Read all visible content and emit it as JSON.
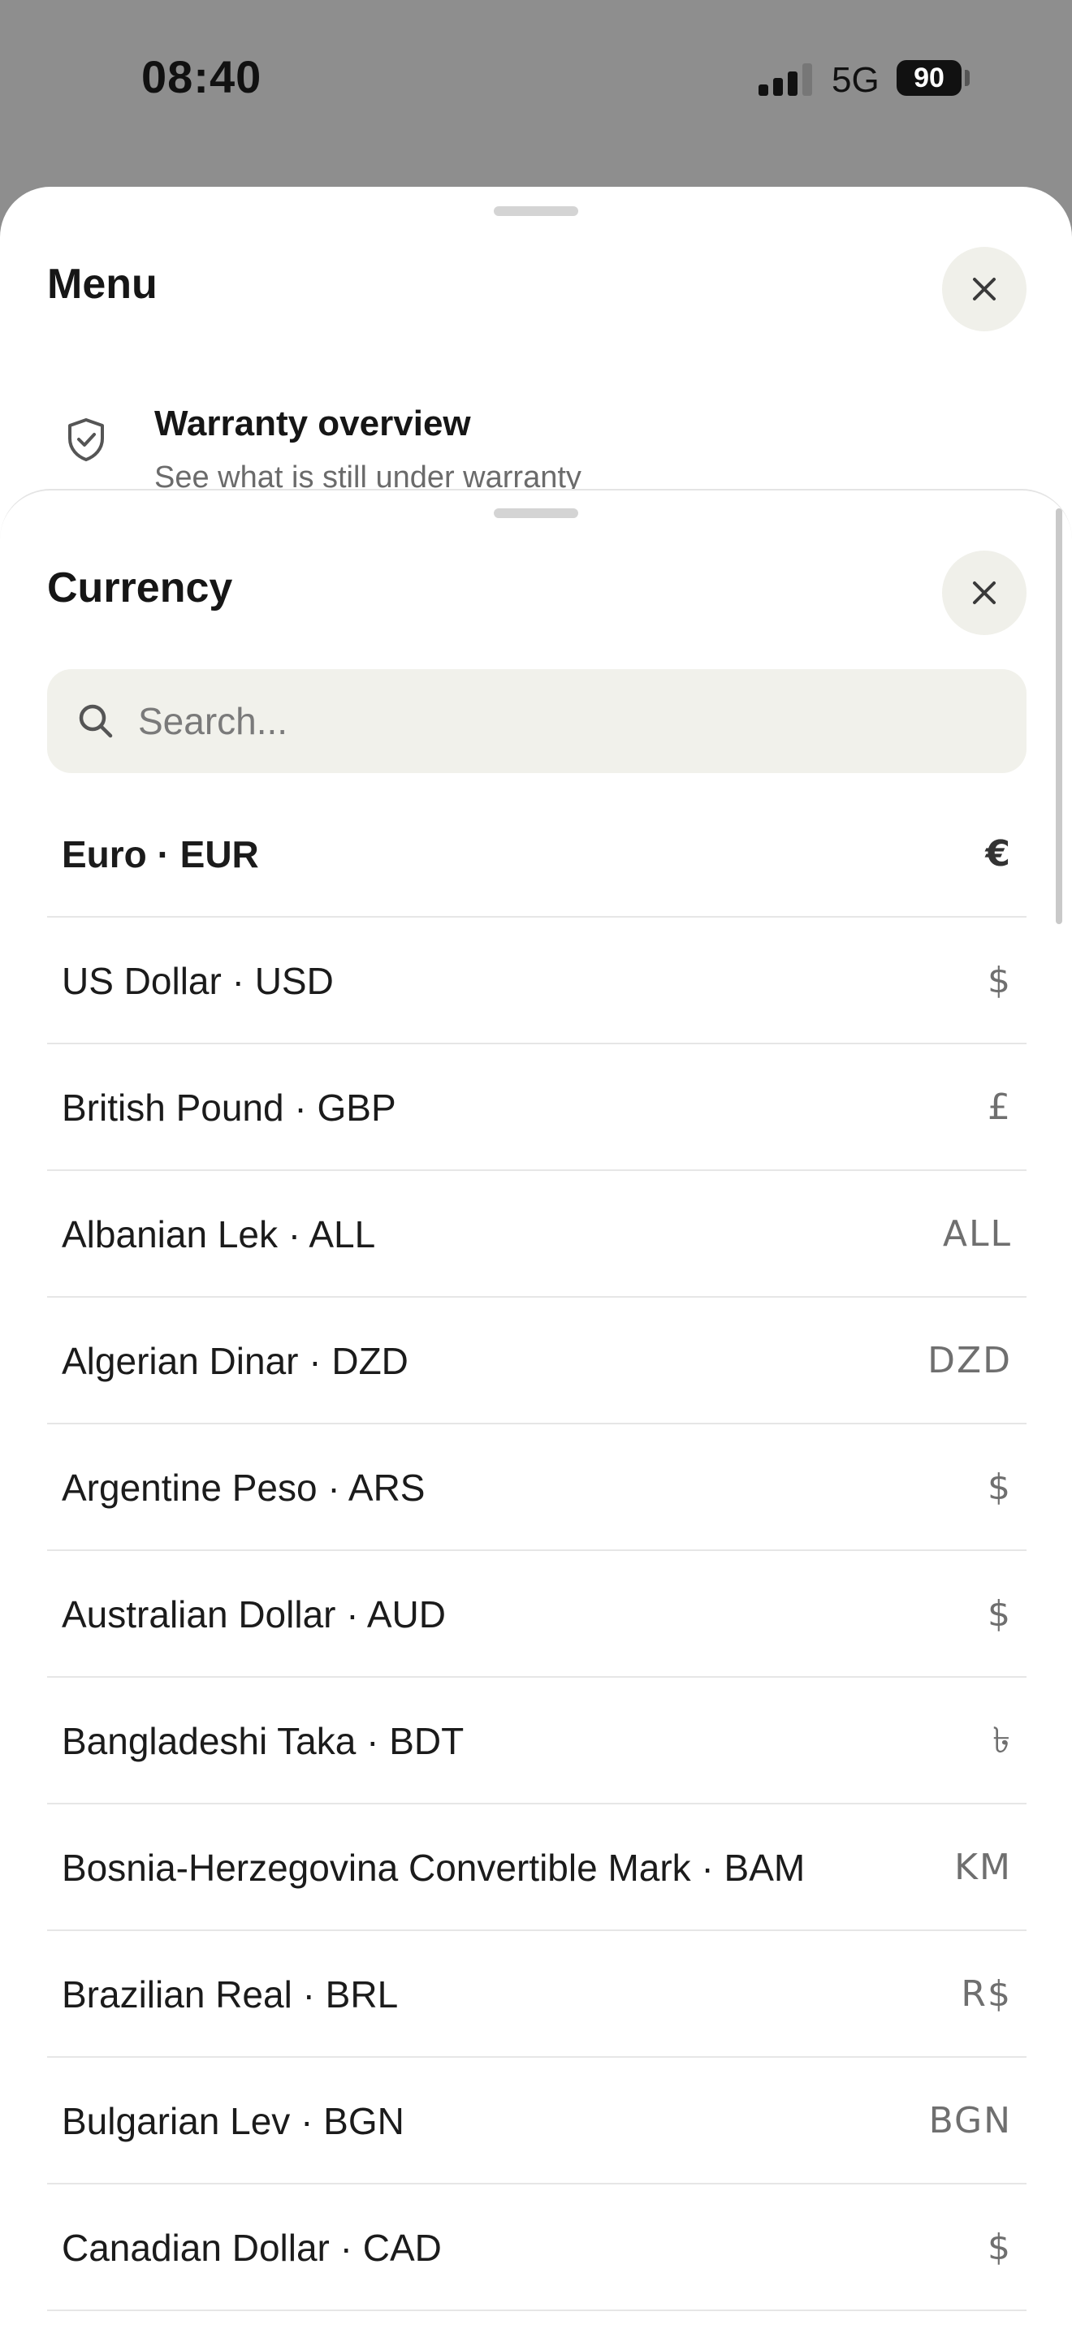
{
  "status_bar": {
    "time": "08:40",
    "network": "5G",
    "battery": "90"
  },
  "menu_sheet": {
    "title": "Menu",
    "items": [
      {
        "icon": "shield-check-icon",
        "title": "Warranty overview",
        "subtitle": "See what is still under warranty"
      }
    ]
  },
  "currency_sheet": {
    "title": "Currency",
    "search": {
      "placeholder": "Search...",
      "value": ""
    },
    "selected": "EUR",
    "currencies": [
      {
        "label": "Euro · EUR",
        "symbol": "€"
      },
      {
        "label": "US Dollar · USD",
        "symbol": "$"
      },
      {
        "label": "British Pound · GBP",
        "symbol": "£"
      },
      {
        "label": "Albanian Lek · ALL",
        "symbol": "ALL"
      },
      {
        "label": "Algerian Dinar · DZD",
        "symbol": "DZD"
      },
      {
        "label": "Argentine Peso · ARS",
        "symbol": "$"
      },
      {
        "label": "Australian Dollar · AUD",
        "symbol": "$"
      },
      {
        "label": "Bangladeshi Taka · BDT",
        "symbol": "৳"
      },
      {
        "label": "Bosnia-Herzegovina Convertible Mark · BAM",
        "symbol": "KM"
      },
      {
        "label": "Brazilian Real · BRL",
        "symbol": "R$"
      },
      {
        "label": "Bulgarian Lev · BGN",
        "symbol": "BGN"
      },
      {
        "label": "Canadian Dollar · CAD",
        "symbol": "$"
      }
    ]
  },
  "colors": {
    "backdrop": "#8e8e8e",
    "sheet": "#ffffff",
    "search_bg": "#f1f1eb",
    "close_bg": "#f0f0ea",
    "text_primary": "#1b1b1b",
    "text_secondary": "#6f6f6f"
  }
}
